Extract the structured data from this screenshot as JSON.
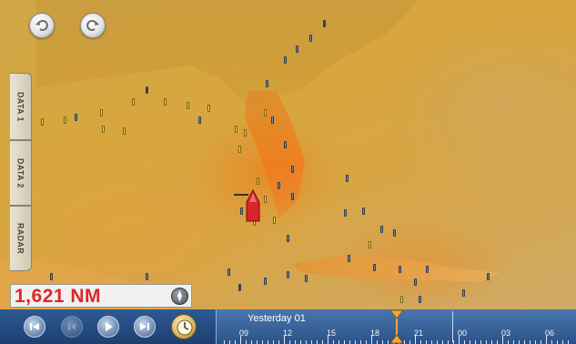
{
  "toolbar": {
    "undo_icon": "undo-icon",
    "redo_icon": "redo-icon"
  },
  "side_tabs": [
    {
      "label": "DATA 1"
    },
    {
      "label": "DATA 2"
    },
    {
      "label": "RADAR"
    }
  ],
  "status": {
    "distance": "1,621 NM",
    "compass_icon": "compass-icon"
  },
  "playback": {
    "buttons": [
      "skip-back-icon",
      "step-back-icon",
      "play-icon",
      "skip-forward-icon"
    ],
    "clock_icon": "clock-icon"
  },
  "timeline": {
    "label": "Yesterday 01",
    "ticks": [
      "09",
      "12",
      "15",
      "18",
      "21",
      "00",
      "03",
      "06"
    ]
  },
  "colors": {
    "accent_red": "#e0242a",
    "bar_blue": "#2d5a95",
    "marker_yellow": "#f4e24a"
  }
}
